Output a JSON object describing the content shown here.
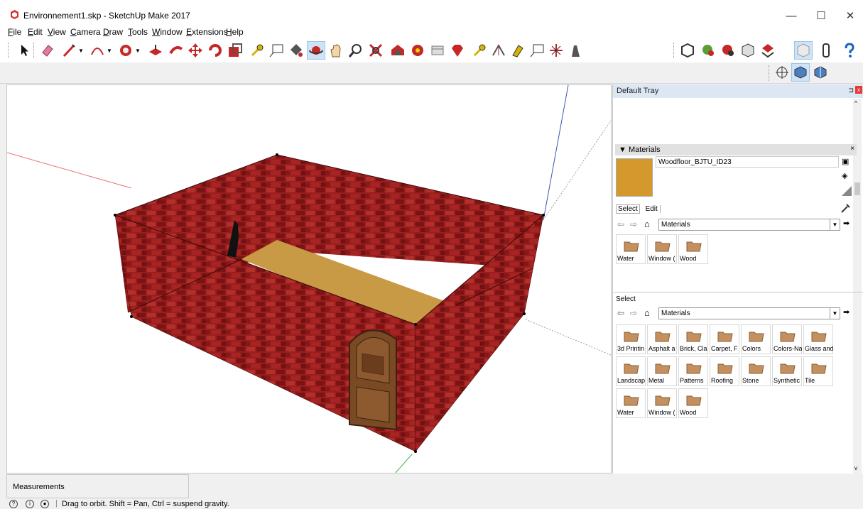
{
  "window": {
    "title": "Environnement1.skp - SketchUp Make 2017",
    "minimize": "—",
    "maximize": "☐",
    "close": "✕"
  },
  "menu": [
    "File",
    "Edit",
    "View",
    "Camera",
    "Draw",
    "Tools",
    "Window",
    "Extensions",
    "Help"
  ],
  "tray": {
    "title": "Default Tray",
    "pin": "⊐",
    "close": "x",
    "materials_panel": {
      "title": "▼ Materials",
      "close": "×",
      "current_material": "Woodfloor_BJTU_ID23",
      "swatch_color": "#d4982d",
      "tabs": [
        "Select",
        "Edit"
      ],
      "library_top": "Materials",
      "library_bottom": "Materials",
      "top_items": [
        {
          "label": "Water"
        },
        {
          "label": "Window ("
        },
        {
          "label": "Wood"
        }
      ],
      "select_label": "Select",
      "bottom_items": [
        {
          "label": "3d Printin"
        },
        {
          "label": "Asphalt a"
        },
        {
          "label": "Brick, Cla"
        },
        {
          "label": "Carpet, F"
        },
        {
          "label": "Colors"
        },
        {
          "label": "Colors-Na"
        },
        {
          "label": "Glass and"
        },
        {
          "label": "Landscap"
        },
        {
          "label": "Metal"
        },
        {
          "label": "Patterns"
        },
        {
          "label": "Roofing"
        },
        {
          "label": "Stone"
        },
        {
          "label": "Synthetic"
        },
        {
          "label": "Tile"
        },
        {
          "label": "Water"
        },
        {
          "label": "Window ("
        },
        {
          "label": "Wood"
        }
      ]
    }
  },
  "measurements": {
    "label": "Measurements"
  },
  "status": {
    "hint": "Drag to orbit. Shift = Pan, Ctrl = suspend gravity."
  },
  "colors": {
    "brick": "#9b1d1d",
    "floor": "#c89a45",
    "door": "#7a4a25"
  }
}
